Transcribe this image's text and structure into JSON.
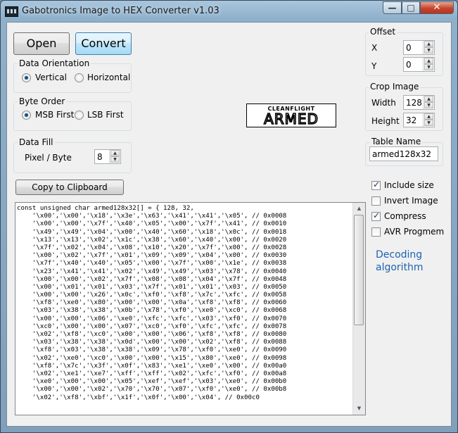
{
  "window": {
    "title": "Gabotronics Image to HEX Converter v1.03",
    "controls": {
      "minimize": "—",
      "maximize": "□",
      "close": "✕"
    }
  },
  "toolbar": {
    "open_label": "Open",
    "convert_label": "Convert"
  },
  "data_orientation": {
    "title": "Data Orientation",
    "options": [
      {
        "label": "Vertical",
        "selected": true
      },
      {
        "label": "Horizontal",
        "selected": false
      }
    ]
  },
  "byte_order": {
    "title": "Byte Order",
    "options": [
      {
        "label": "MSB First",
        "selected": true
      },
      {
        "label": "LSB First",
        "selected": false
      }
    ]
  },
  "data_fill": {
    "title": "Data Fill",
    "pixel_label": "Pixel / Byte",
    "pixel_value": "8"
  },
  "preview_logo": {
    "top_text": "CLEANFLIGHT",
    "main_text": "ARMED"
  },
  "offset": {
    "title": "Offset",
    "x_label": "X",
    "x_value": "0",
    "y_label": "Y",
    "y_value": "0"
  },
  "crop_image": {
    "title": "Crop Image",
    "width_label": "Width",
    "width_value": "128",
    "height_label": "Height",
    "height_value": "32"
  },
  "table_name": {
    "title": "Table Name",
    "value": "armed128x32"
  },
  "options": [
    {
      "label": "Include size",
      "checked": true
    },
    {
      "label": "Invert Image",
      "checked": false
    },
    {
      "label": "Compress",
      "checked": true
    },
    {
      "label": "AVR Progmem",
      "checked": false
    }
  ],
  "decoding_link": "Decoding algorithm",
  "copy_button": "Copy to Clipboard",
  "code_lines": [
    "const unsigned char armed128x32[] = { 128, 32,",
    "    '\\x00','\\x00','\\x18','\\x3e','\\x63','\\x41','\\x41','\\x05', // 0x0008",
    "    '\\x00','\\x00','\\x7f','\\x40','\\x05','\\x00','\\x7f','\\x41', // 0x0010",
    "    '\\x49','\\x49','\\x04','\\x00','\\x40','\\x60','\\x18','\\x0c', // 0x0018",
    "    '\\x13','\\x13','\\x02','\\x1c','\\x38','\\x60','\\x40','\\x00', // 0x0020",
    "    '\\x7f','\\x02','\\x04','\\x08','\\x10','\\x20','\\x7f','\\x00', // 0x0028",
    "    '\\x00','\\x02','\\x7f','\\x01','\\x09','\\x09','\\x04','\\x00', // 0x0030",
    "    '\\x7f','\\x40','\\x40','\\x05','\\x00','\\x7f','\\x00','\\x1e', // 0x0038",
    "    '\\x23','\\x41','\\x41','\\x02','\\x49','\\x49','\\x03','\\x78', // 0x0040",
    "    '\\x00','\\x00','\\x02','\\x7f','\\x08','\\x08','\\x04','\\x7f', // 0x0048",
    "    '\\x00','\\x01','\\x01','\\x03','\\x7f','\\x01','\\x01','\\x03', // 0x0050",
    "    '\\x00','\\x00','\\x26','\\x0c','\\xf0','\\xf8','\\x7c','\\xfc', // 0x0058",
    "    '\\xf8','\\xe0','\\x80','\\x00','\\x00','\\x0a','\\xf8','\\xf8', // 0x0060",
    "    '\\x03','\\x38','\\x38','\\x0b','\\x78','\\xf0','\\xe0','\\xc0', // 0x0068",
    "    '\\x00','\\x00','\\x06','\\xe0','\\xfc','\\xfc','\\x03','\\xf0', // 0x0070",
    "    '\\xc0','\\x00','\\x00','\\x07','\\xc0','\\xf0','\\xfc','\\xfc', // 0x0078",
    "    '\\x02','\\xf8','\\xc0','\\x00','\\x00','\\x06','\\xf8','\\xf8', // 0x0080",
    "    '\\x03','\\x38','\\x38','\\x0d','\\x00','\\x00','\\x02','\\xf8', // 0x0088",
    "    '\\xf8','\\x03','\\x38','\\x38','\\x09','\\x78','\\xf0','\\xe0', // 0x0090",
    "    '\\x02','\\xe0','\\xc0','\\x00','\\x00','\\x15','\\x80','\\xe0', // 0x0098",
    "    '\\xf8','\\x7c','\\x3f','\\x0f','\\x83','\\xe1','\\xe0','\\x00', // 0x00a0",
    "    '\\x02','\\xe1','\\xe7','\\xff','\\xff','\\x02','\\xfc','\\xf0', // 0x00a8",
    "    '\\xe0','\\x00','\\x00','\\x05','\\xef','\\xef','\\x03','\\xe0', // 0x00b0",
    "    '\\x00','\\x00','\\x02','\\x70','\\x70','\\x07','\\xf0','\\xe0', // 0x00b8",
    "    '\\x02','\\xf8','\\xbf','\\x1f','\\x0f','\\x00','\\x04', // 0x00c0"
  ]
}
